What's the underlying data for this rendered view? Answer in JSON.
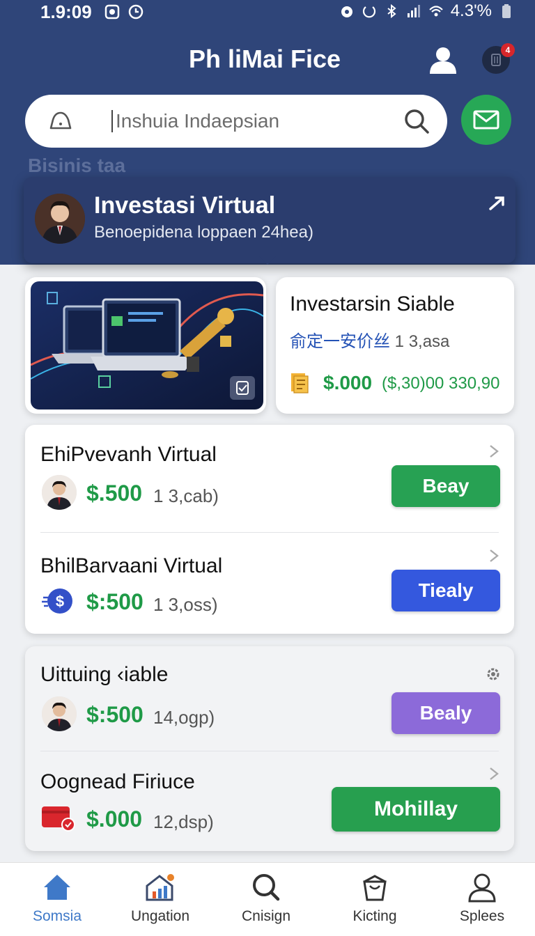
{
  "status_bar": {
    "time": "1.9:09",
    "battery": "4.3'%"
  },
  "header": {
    "title": "Ph liMai Fice"
  },
  "notifications": {
    "badge": "4"
  },
  "search": {
    "placeholder": "Inshuia Indaepsian"
  },
  "section": {
    "label": "Bisinis taa"
  },
  "featured": {
    "title": "Investasi Virtual",
    "subtitle": "Benoepidena loppaen 24hea)"
  },
  "info_card": {
    "title": "Investarsin Siable",
    "subtitle_cjk": "俞定一安价丝",
    "subtitle_num": "1 3,asa",
    "price": "$.000",
    "price_note": "($,30)00 330,90"
  },
  "items": [
    {
      "name": "EhiPvevanh Virtual",
      "price": "$.500",
      "note": "1 3,cab)",
      "button": "Beay",
      "button_color": "#27a153"
    },
    {
      "name": "BhilBarvaani Virtual",
      "price": "$:500",
      "note": "1 3,oss)",
      "button": "Tiealy",
      "button_color": "#3458de"
    },
    {
      "name": "Uittuing ‹iable",
      "price": "$:500",
      "note": "14,ogp)",
      "button": "Bealy",
      "button_color": "#8c6ad9"
    },
    {
      "name": "Oognead Firiuce",
      "price": "$.000",
      "note": "12,dsp)",
      "button": "Mohillay",
      "button_color": "#279f4f"
    }
  ],
  "nav": [
    {
      "label": "Somsia",
      "icon": "home-icon"
    },
    {
      "label": "Ungation",
      "icon": "chart-house-icon"
    },
    {
      "label": "Cnisign",
      "icon": "search-icon"
    },
    {
      "label": "Kicting",
      "icon": "bag-icon"
    },
    {
      "label": "Splees",
      "icon": "profile-icon"
    }
  ],
  "colors": {
    "header": "#2f4579",
    "accent_green": "#1f9a47",
    "active_nav": "#3f79c8"
  }
}
